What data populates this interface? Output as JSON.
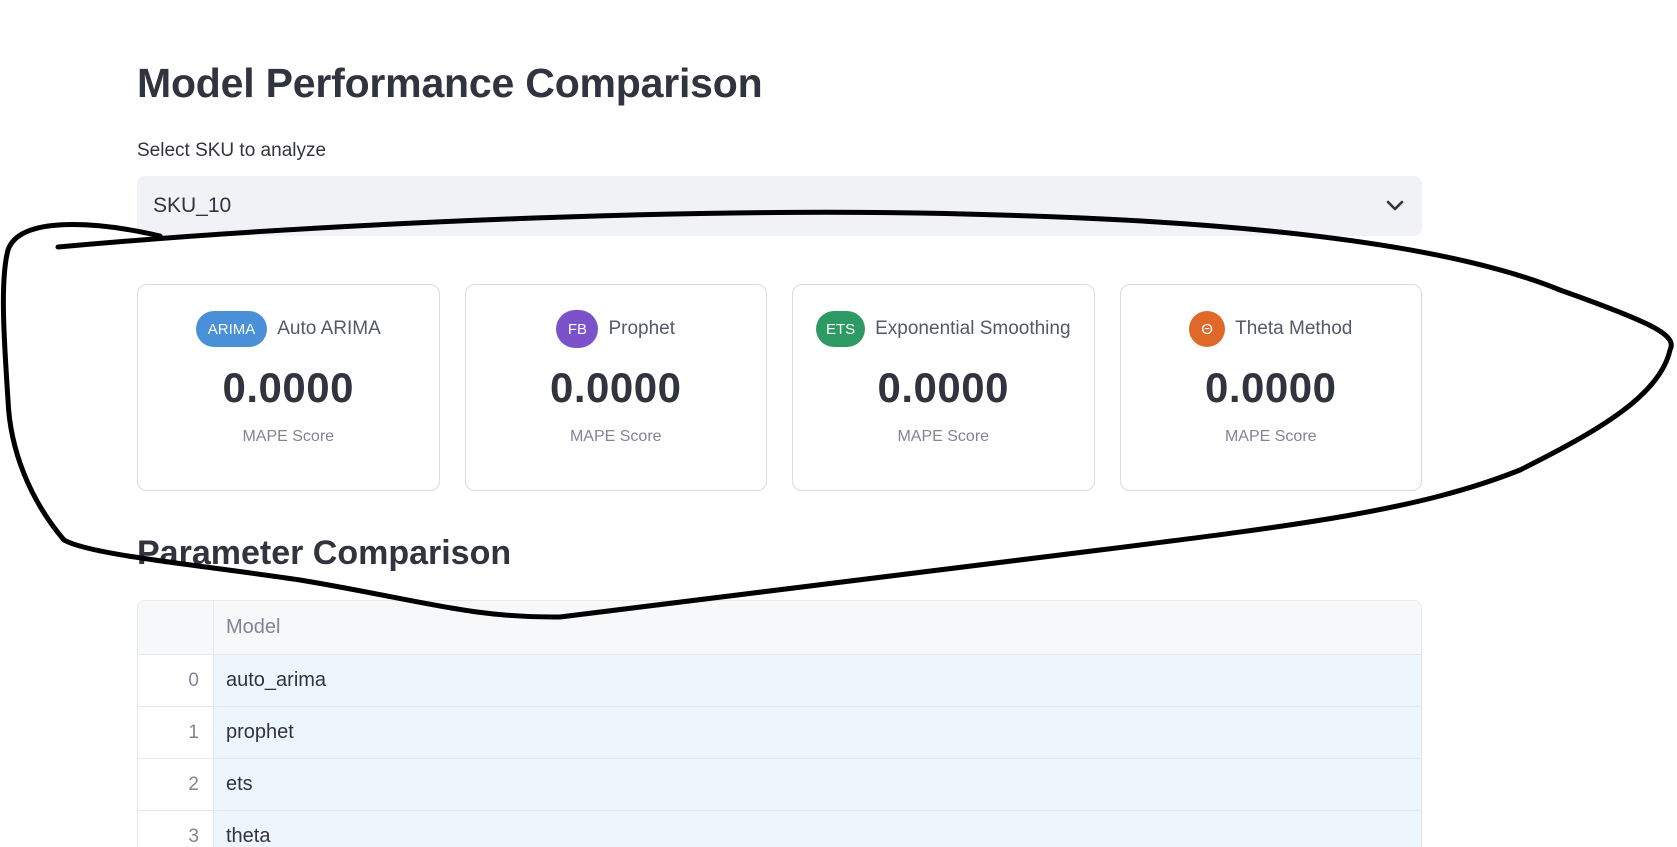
{
  "page": {
    "title": "Model Performance Comparison"
  },
  "sku_select": {
    "label": "Select SKU to analyze",
    "value": "SKU_10"
  },
  "cards": [
    {
      "badge": "ARIMA",
      "name": "Auto ARIMA",
      "value": "0.0000",
      "sub": "MAPE Score",
      "color": "#4a90d9"
    },
    {
      "badge": "FB",
      "name": "Prophet",
      "value": "0.0000",
      "sub": "MAPE Score",
      "color": "#7b52c9"
    },
    {
      "badge": "ETS",
      "name": "Exponential Smoothing",
      "value": "0.0000",
      "sub": "MAPE Score",
      "color": "#2e9a63"
    },
    {
      "badge": "Θ",
      "name": "Theta Method",
      "value": "0.0000",
      "sub": "MAPE Score",
      "color": "#e0692a"
    }
  ],
  "parameter_section": {
    "title": "Parameter Comparison",
    "table": {
      "columns": [
        "",
        "Model"
      ],
      "rows": [
        {
          "index": "0",
          "model": "auto_arima"
        },
        {
          "index": "1",
          "model": "prophet"
        },
        {
          "index": "2",
          "model": "ets"
        },
        {
          "index": "3",
          "model": "theta"
        }
      ]
    }
  },
  "colors": {
    "text": "#31333f",
    "select_bg": "#f0f2f6",
    "row_highlight": "#eef6fd",
    "annotation_stroke": "#000000"
  }
}
